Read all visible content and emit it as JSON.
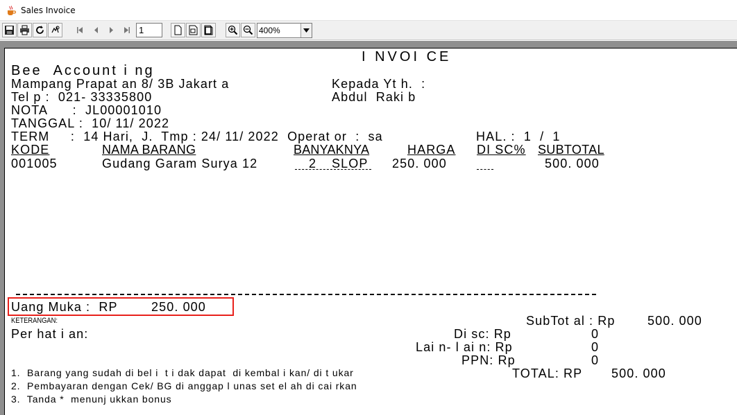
{
  "window": {
    "title": "Sales Invoice"
  },
  "toolbar": {
    "page_number": "1",
    "zoom": "400%",
    "icons": [
      "save-icon",
      "print-icon",
      "reload-icon",
      "fit-icon",
      "first-page-icon",
      "prev-page-icon",
      "next-page-icon",
      "last-page-icon",
      "single-page-icon",
      "fit-width-icon",
      "actual-size-icon",
      "zoom-in-icon",
      "zoom-out-icon",
      "dropdown-arrow-icon"
    ]
  },
  "invoice": {
    "title": "I NVOI CE",
    "company": "Bee  Account i ng",
    "address": "Mampang Prapat an 8/ 3B Jakart a",
    "phone": "Tel p :  021- 33335800",
    "to_label": "Kepada Yt h.  :",
    "to_name": "Abdul  Raki b",
    "nota": "NOTA      :  JL00001010",
    "tanggal": "TANGGAL :  10/ 11/ 2022",
    "term": "TERM     :  14 Hari,  J.  Tmp : 24/ 11/ 2022  Operat or  :  sa",
    "hal": "HAL. :  1  /  1",
    "headers": {
      "kode": "KODE",
      "nama": "NAMA BARANG",
      "banyaknya": "BANYAKNYA",
      "harga": "HARGA",
      "disc": "DI SC%",
      "subtotal": "SUBTOTAL"
    },
    "items": [
      {
        "kode": "001005",
        "nama": "Gudang Garam Surya 12",
        "qty": "2",
        "unit": "SLOP",
        "harga": "250. 000",
        "subtotal": "500. 000"
      }
    ],
    "uang_muka": "Uang Muka :  RP        250. 000",
    "keterangan": "KETERANGAN:",
    "perhatian": "Per hat i an:",
    "subtotal_label": "SubTot al : Rp",
    "subtotal_value": "500. 000",
    "disc_label": "Di sc: Rp",
    "disc_value": "0",
    "lain_label": "Lai n- l ai n: Rp",
    "lain_value": "0",
    "ppn_label": "PPN: Rp",
    "ppn_value": "0",
    "total_label": "TOTAL: RP",
    "total_value": "500. 000",
    "notes": [
      "1.  Barang yang sudah di bel i  t i dak dapat  di kembal i kan/ di t ukar",
      "2.  Pembayaran dengan Cek/ BG di anggap l unas set el ah di cai rkan",
      "3.  Tanda *  menunj ukkan bonus"
    ]
  }
}
